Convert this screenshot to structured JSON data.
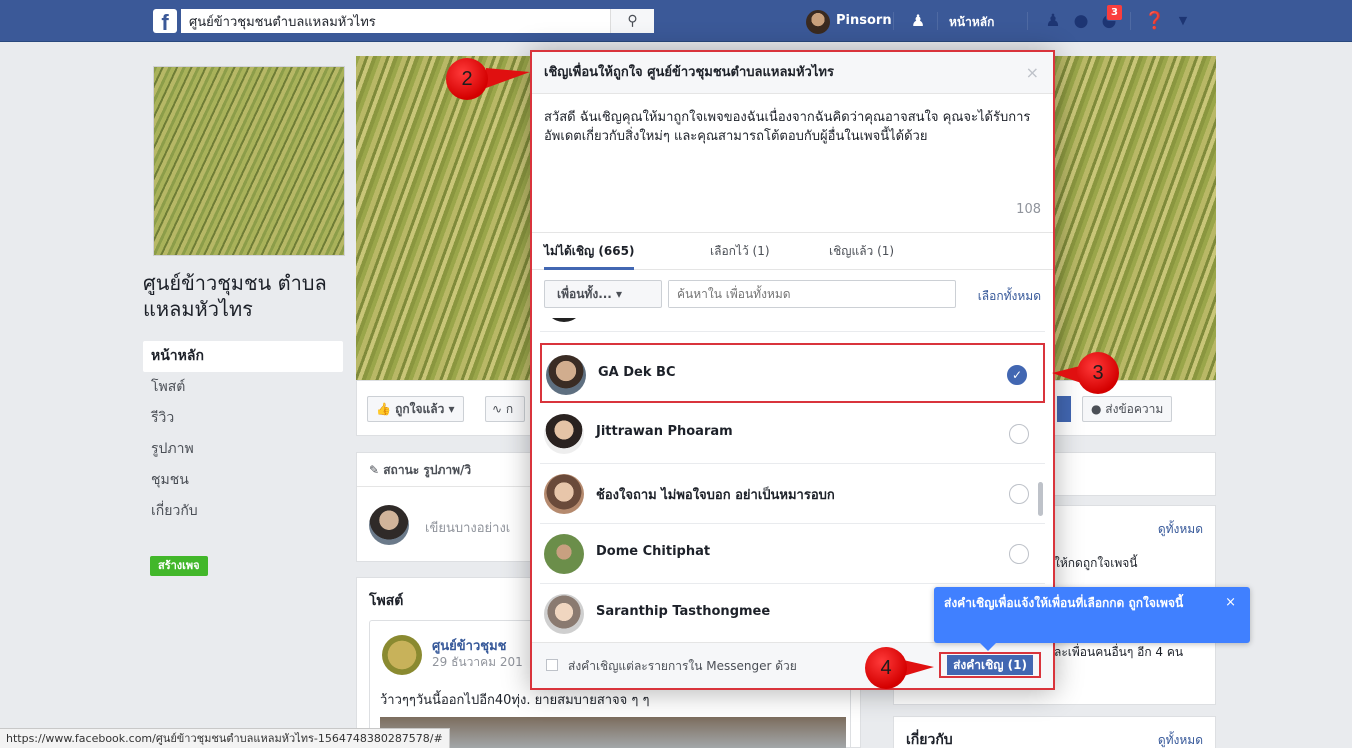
{
  "topbar": {
    "search_value": "ศูนย์ข้าวชุมชนตำบลแหลมหัวไทร",
    "user_name": "Pinsorn",
    "home_label": "หน้าหลัก",
    "notifications_count": "3"
  },
  "sidebar": {
    "page_name": "ศูนย์ข้าวชุมชน ตำบลแหลมหัวไทร",
    "items": [
      {
        "label": "หน้าหลัก"
      },
      {
        "label": "โพสต์"
      },
      {
        "label": "รีวิว"
      },
      {
        "label": "รูปภาพ"
      },
      {
        "label": "ชุมชน"
      },
      {
        "label": "เกี่ยวกับ"
      }
    ],
    "create_page_label": "สร้างเพจ"
  },
  "actionbar": {
    "liked_label": "ถูกใจแล้ว ▾",
    "follow_label": "ก",
    "message_label": "ส่งข้อความ"
  },
  "composer": {
    "tabs_label": "สถานะ  รูปภาพ/วิ",
    "placeholder": "เขียนบางอย่างเ"
  },
  "posts": {
    "title": "โพสต์",
    "author": "ศูนย์ข้าวชุมช",
    "date": "29 ธันวาคม 201",
    "text": "ว้าวๆๆวันนี้ออกไปอีก40ทุ่ง. ยายสมบายสาจจ ๆ ๆ"
  },
  "right_cards": {
    "card1_link": "ดูทั้งหมด",
    "card1_text": "ให้กดถูกใจเพจนี้",
    "card2_text": "ละเพื่อนคนอื่นๆ อีก 4 คน",
    "about_title": "เกี่ยวกับ",
    "about_link": "ดูทั้งหมด"
  },
  "statusbar": {
    "url": "https://www.facebook.com/ศูนย์ข้าวชุมชนตำบลแหลมหัวไทร-1564748380287578/#"
  },
  "dialog": {
    "title": "เชิญเพื่อนให้ถูกใจ ศูนย์ข้าวชุมชนตำบลแหลมหัวไทร",
    "close": "×",
    "message": "สวัสดี ฉันเชิญคุณให้มาถูกใจเพจของฉันเนื่องจากฉันคิดว่าคุณอาจสนใจ คุณจะได้รับการอัพเดตเกี่ยวกับสิ่งใหม่ๆ และคุณสามารถโต้ตอบกับผู้อื่นในเพจนี้ได้ด้วย",
    "char_count": "108",
    "tabs": [
      {
        "label": "ไม่ได้เชิญ (665)"
      },
      {
        "label": "เลือกไว้ (1)"
      },
      {
        "label": "เชิญแล้ว (1)"
      }
    ],
    "filter_label": "เพื่อนทั้ง... ▾",
    "filter_placeholder": "ค้นหาใน เพื่อนทั้งหมด",
    "select_all": "เลือกทั้งหมด",
    "friends": [
      {
        "name": "GA Dek BC",
        "selected": true
      },
      {
        "name": "Jittrawan Phoaram",
        "selected": false
      },
      {
        "name": "ช้องใจถาม ไม่พอใจบอก อย่าเป็นหมารอบก",
        "selected": false
      },
      {
        "name": "Dome Chitiphat",
        "selected": false
      },
      {
        "name": "Saranthip Tasthongmee",
        "selected": false
      }
    ],
    "footer_label": "ส่งคำเชิญแต่ละรายการใน Messenger ด้วย",
    "send_label": "ส่งคำเชิญ (1)"
  },
  "tooltip": {
    "text": "ส่งคำเชิญเพื่อแจ้งให้เพื่อนที่เลือกกด ถูกใจเพจนี้",
    "close": "×"
  },
  "markers": {
    "m2": "2",
    "m3": "3",
    "m4": "4"
  },
  "colors": {
    "facebook_blue": "#3b5998",
    "button_blue": "#4267b2",
    "highlight_red": "#d9343c",
    "tooltip_blue": "#4080ff",
    "create_green": "#42b72a"
  }
}
